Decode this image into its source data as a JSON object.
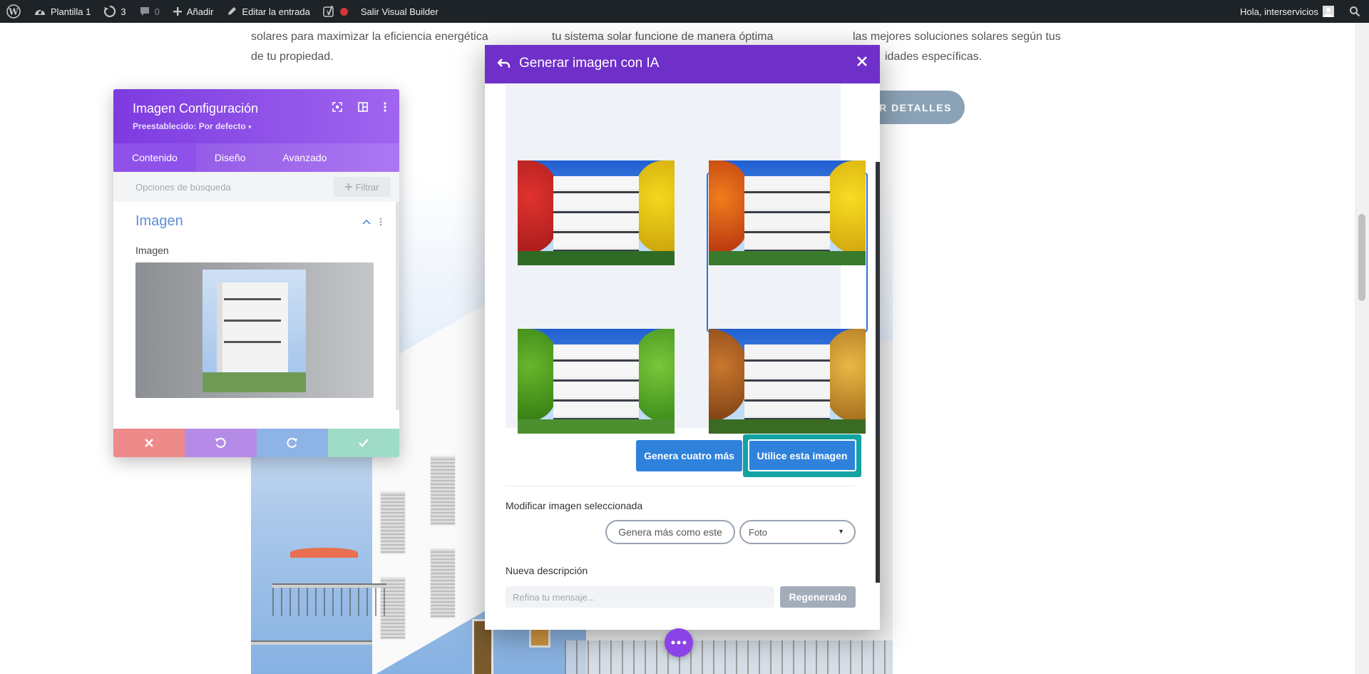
{
  "adminbar": {
    "site_name": "Plantilla 1",
    "updates_count": "3",
    "comments_count": "0",
    "add_new": "Añadir",
    "edit_entry": "Editar la entrada",
    "exit_builder": "Salir Visual Builder",
    "greeting": "Hola, interservicios"
  },
  "page": {
    "col1_line1": "solares para maximizar la eficiencia energética",
    "col1_line2": "de tu propiedad.",
    "col2_line1": "tu sistema solar funcione de manera óptima",
    "col3_line1": "las mejores soluciones solares según tus",
    "col3_line2": "idades específicas.",
    "details_button": "R DETALLES"
  },
  "settings": {
    "title": "Imagen Configuración",
    "preset": "Preestablecido: Por defecto",
    "tabs": [
      {
        "label": "Contenido"
      },
      {
        "label": "Diseño"
      },
      {
        "label": "Avanzado"
      }
    ],
    "search_placeholder": "Opciones de búsqueda",
    "filter_label": "Filtrar",
    "section_title": "Imagen",
    "field_label": "Imagen"
  },
  "modal": {
    "title": "Generar imagen con IA",
    "generate_four": "Genera cuatro más",
    "use_image": "Utilice esta imagen",
    "modify_label": "Modificar imagen seleccionada",
    "generate_similar": "Genera más como este",
    "style_select": "Foto",
    "new_description_label": "Nueva descripción",
    "refine_placeholder": "Refina tu mensaje...",
    "regenerate": "Regenerado"
  },
  "colors": {
    "admin_bar": "#1d2327",
    "modal_header": "#6f2fc9",
    "settings_header": "#7d3be0",
    "primary_button": "#2f82dc",
    "use_button_highlight": "#12a3a3"
  }
}
